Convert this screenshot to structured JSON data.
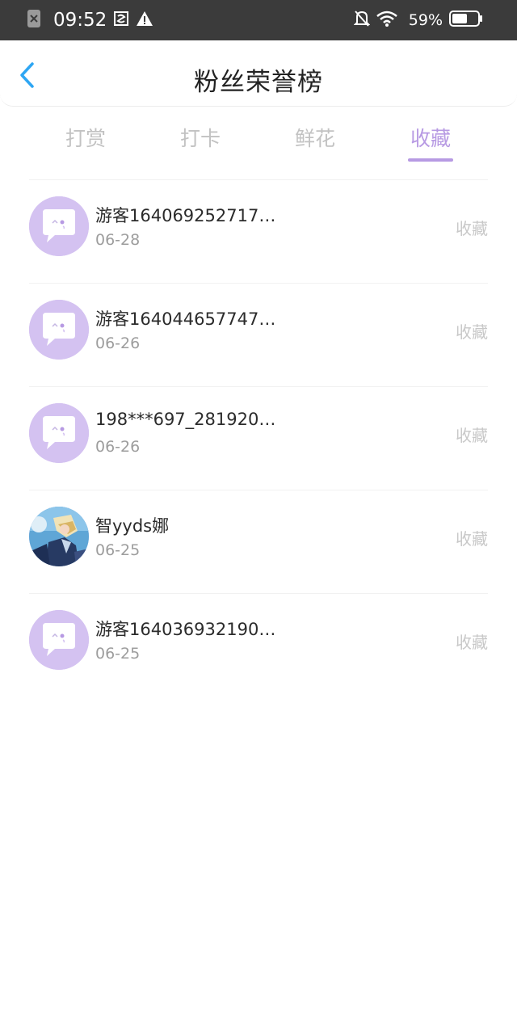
{
  "status_bar": {
    "time": "09:52",
    "battery_percent": "59%",
    "battery_level": 0.59,
    "icons": [
      "close-box-icon",
      "screenshot-icon",
      "warning-icon",
      "bell-off-icon",
      "wifi-icon",
      "battery-icon"
    ]
  },
  "header": {
    "title": "粉丝荣誉榜",
    "back_icon": "chevron-left-icon"
  },
  "tabs": [
    {
      "label": "打赏",
      "active": false
    },
    {
      "label": "打卡",
      "active": false
    },
    {
      "label": "鲜花",
      "active": false
    },
    {
      "label": "收藏",
      "active": true
    }
  ],
  "colors": {
    "accent": "#b79ae3",
    "avatar_bg": "#d4c2f1",
    "statusbar_bg": "#3b3b3b"
  },
  "list": [
    {
      "name": "游客164069252717…",
      "date": "06-28",
      "action": "收藏",
      "avatar": "chat-bubble-avatar-icon"
    },
    {
      "name": "游客164044657747…",
      "date": "06-26",
      "action": "收藏",
      "avatar": "chat-bubble-avatar-icon"
    },
    {
      "name": "198***697_281920…",
      "date": "06-26",
      "action": "收藏",
      "avatar": "chat-bubble-avatar-icon"
    },
    {
      "name": "智yyds娜",
      "date": "06-25",
      "action": "收藏",
      "avatar": "photo-avatar"
    },
    {
      "name": "游客164036932190…",
      "date": "06-25",
      "action": "收藏",
      "avatar": "chat-bubble-avatar-icon"
    }
  ]
}
